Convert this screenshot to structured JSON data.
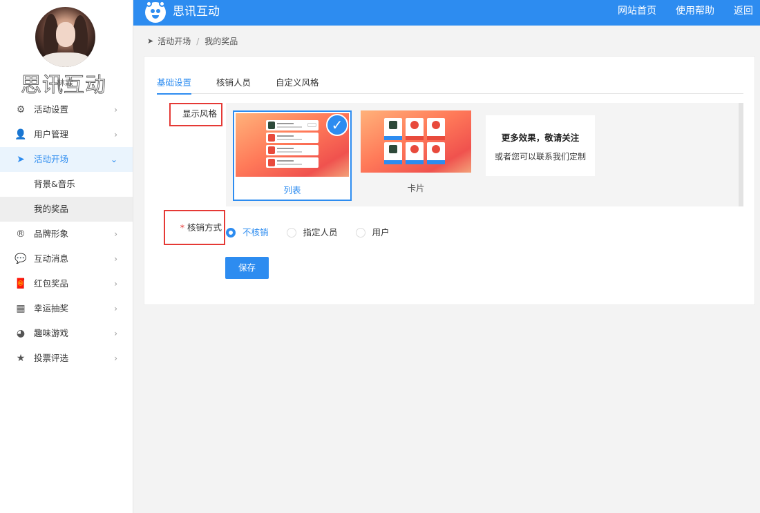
{
  "app": {
    "title": "思讯互动",
    "watermark": "思讯互动",
    "watermark_small": "林霖"
  },
  "topbar": {
    "links": [
      "网站首页",
      "使用帮助",
      "返回"
    ]
  },
  "sidebar": {
    "items": [
      {
        "label": "活动设置",
        "icon": "gears-icon",
        "expanded": false
      },
      {
        "label": "用户管理",
        "icon": "user-card-icon",
        "expanded": false
      },
      {
        "label": "活动开场",
        "icon": "paper-plane-icon",
        "expanded": true,
        "active": true
      },
      {
        "label": "背景&音乐",
        "sub": true
      },
      {
        "label": "我的奖品",
        "sub": true,
        "selected": true
      },
      {
        "label": "品牌形象",
        "icon": "registered-icon",
        "expanded": false
      },
      {
        "label": "互动消息",
        "icon": "chat-bubble-icon",
        "expanded": false
      },
      {
        "label": "红包奖品",
        "icon": "red-packet-icon",
        "expanded": false
      },
      {
        "label": "幸运抽奖",
        "icon": "lottery-icon",
        "expanded": false
      },
      {
        "label": "趣味游戏",
        "icon": "gamepad-icon",
        "expanded": false
      },
      {
        "label": "投票评选",
        "icon": "star-icon",
        "expanded": false
      }
    ]
  },
  "breadcrumb": {
    "items": [
      "活动开场",
      "我的奖品"
    ],
    "separator": "/"
  },
  "tabs": [
    {
      "label": "基础设置",
      "active": true
    },
    {
      "label": "核销人员",
      "active": false
    },
    {
      "label": "自定义风格",
      "active": false
    }
  ],
  "form": {
    "display_style_label": "显示风格",
    "styles": [
      {
        "caption": "列表",
        "selected": true
      },
      {
        "caption": "卡片",
        "selected": false
      }
    ],
    "more": {
      "title": "更多效果，敬请关注",
      "subtitle": "或者您可以联系我们定制"
    },
    "verify_label": "核销方式",
    "verify_required_mark": "*",
    "verify_options": [
      {
        "label": "不核销",
        "checked": true
      },
      {
        "label": "指定人员",
        "checked": false
      },
      {
        "label": "用户",
        "checked": false
      }
    ],
    "save_label": "保存"
  },
  "colors": {
    "accent": "#2d8cf0",
    "highlight_box": "#e53935",
    "thumb_gradient_start": "#ffb27a",
    "thumb_gradient_end": "#f0524e"
  }
}
